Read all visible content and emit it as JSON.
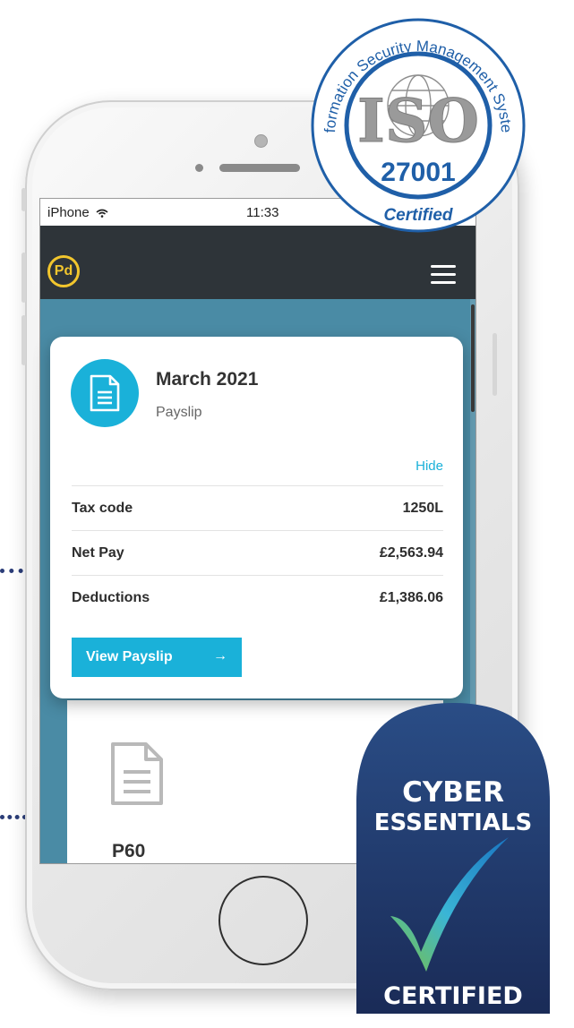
{
  "status_bar": {
    "carrier": "iPhone",
    "time": "11:33"
  },
  "app": {
    "logo_text": "Pd"
  },
  "payslip_card": {
    "month": "March 2021",
    "type": "Payslip",
    "hide_label": "Hide",
    "rows": [
      {
        "label": "Tax code",
        "value": "1250L"
      },
      {
        "label": "Net Pay",
        "value": "£2,563.94"
      },
      {
        "label": "Deductions",
        "value": "£1,386.06"
      }
    ],
    "view_button": {
      "label": "View Payslip",
      "arrow": "→"
    }
  },
  "p60_card": {
    "title": "P60"
  },
  "iso_badge": {
    "ring_text": "Information Security Management System",
    "logo": "ISO",
    "number": "27001",
    "certified": "Certified"
  },
  "cyber_badge": {
    "line1": "CYBER",
    "line2": "ESSENTIALS",
    "bottom": "CERTIFIED"
  },
  "colors": {
    "accent": "#1ab1d9",
    "navbar": "#2e3439",
    "screen_bg": "#4a8ba5",
    "logo_yellow": "#f2c62d",
    "cyber_navy": "#1d2f5e"
  },
  "icons": [
    "wifi-icon",
    "menu-icon",
    "document-icon",
    "arrow-right-icon",
    "check-icon"
  ]
}
